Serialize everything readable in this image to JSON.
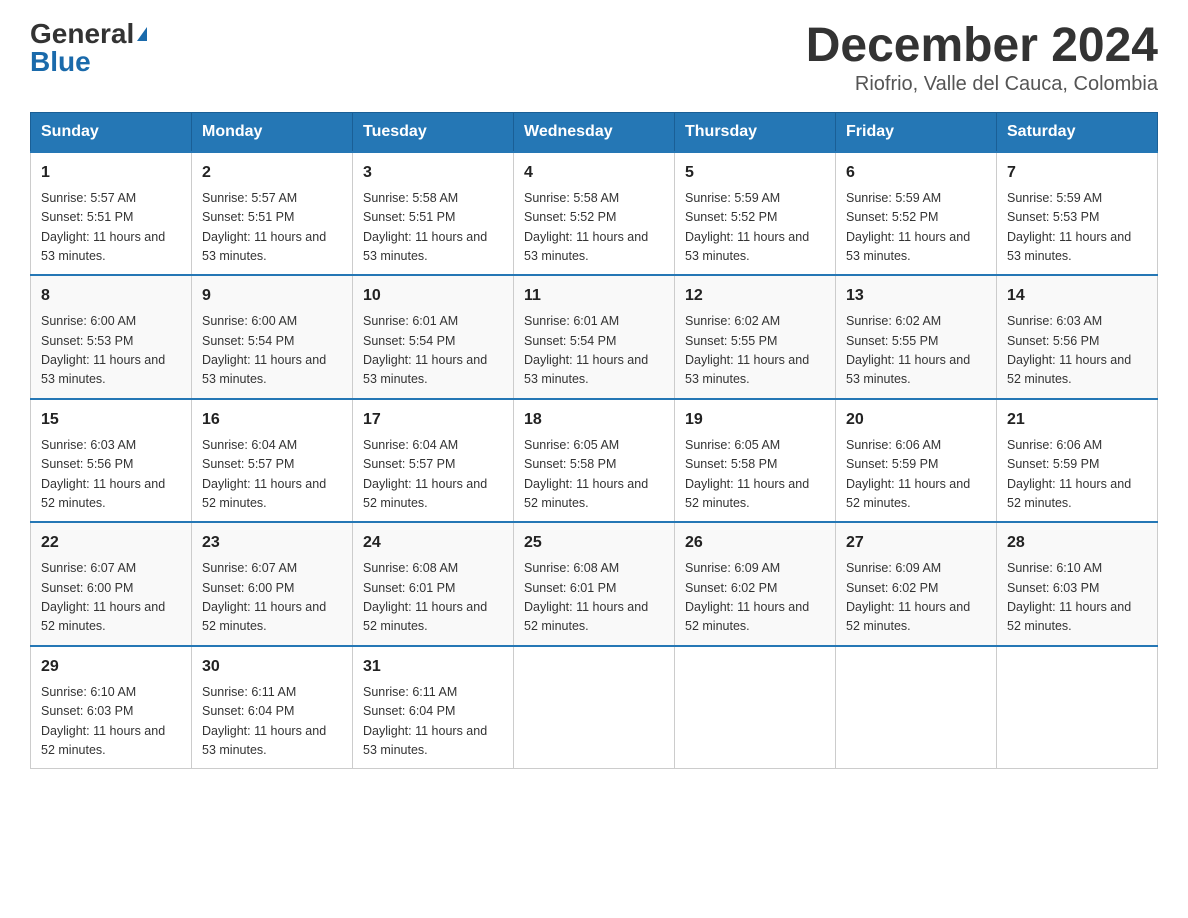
{
  "header": {
    "logo_general": "General",
    "logo_blue": "Blue",
    "month_title": "December 2024",
    "location": "Riofrio, Valle del Cauca, Colombia"
  },
  "days_of_week": [
    "Sunday",
    "Monday",
    "Tuesday",
    "Wednesday",
    "Thursday",
    "Friday",
    "Saturday"
  ],
  "weeks": [
    [
      {
        "day": "1",
        "sunrise": "5:57 AM",
        "sunset": "5:51 PM",
        "daylight": "11 hours and 53 minutes."
      },
      {
        "day": "2",
        "sunrise": "5:57 AM",
        "sunset": "5:51 PM",
        "daylight": "11 hours and 53 minutes."
      },
      {
        "day": "3",
        "sunrise": "5:58 AM",
        "sunset": "5:51 PM",
        "daylight": "11 hours and 53 minutes."
      },
      {
        "day": "4",
        "sunrise": "5:58 AM",
        "sunset": "5:52 PM",
        "daylight": "11 hours and 53 minutes."
      },
      {
        "day": "5",
        "sunrise": "5:59 AM",
        "sunset": "5:52 PM",
        "daylight": "11 hours and 53 minutes."
      },
      {
        "day": "6",
        "sunrise": "5:59 AM",
        "sunset": "5:52 PM",
        "daylight": "11 hours and 53 minutes."
      },
      {
        "day": "7",
        "sunrise": "5:59 AM",
        "sunset": "5:53 PM",
        "daylight": "11 hours and 53 minutes."
      }
    ],
    [
      {
        "day": "8",
        "sunrise": "6:00 AM",
        "sunset": "5:53 PM",
        "daylight": "11 hours and 53 minutes."
      },
      {
        "day": "9",
        "sunrise": "6:00 AM",
        "sunset": "5:54 PM",
        "daylight": "11 hours and 53 minutes."
      },
      {
        "day": "10",
        "sunrise": "6:01 AM",
        "sunset": "5:54 PM",
        "daylight": "11 hours and 53 minutes."
      },
      {
        "day": "11",
        "sunrise": "6:01 AM",
        "sunset": "5:54 PM",
        "daylight": "11 hours and 53 minutes."
      },
      {
        "day": "12",
        "sunrise": "6:02 AM",
        "sunset": "5:55 PM",
        "daylight": "11 hours and 53 minutes."
      },
      {
        "day": "13",
        "sunrise": "6:02 AM",
        "sunset": "5:55 PM",
        "daylight": "11 hours and 53 minutes."
      },
      {
        "day": "14",
        "sunrise": "6:03 AM",
        "sunset": "5:56 PM",
        "daylight": "11 hours and 52 minutes."
      }
    ],
    [
      {
        "day": "15",
        "sunrise": "6:03 AM",
        "sunset": "5:56 PM",
        "daylight": "11 hours and 52 minutes."
      },
      {
        "day": "16",
        "sunrise": "6:04 AM",
        "sunset": "5:57 PM",
        "daylight": "11 hours and 52 minutes."
      },
      {
        "day": "17",
        "sunrise": "6:04 AM",
        "sunset": "5:57 PM",
        "daylight": "11 hours and 52 minutes."
      },
      {
        "day": "18",
        "sunrise": "6:05 AM",
        "sunset": "5:58 PM",
        "daylight": "11 hours and 52 minutes."
      },
      {
        "day": "19",
        "sunrise": "6:05 AM",
        "sunset": "5:58 PM",
        "daylight": "11 hours and 52 minutes."
      },
      {
        "day": "20",
        "sunrise": "6:06 AM",
        "sunset": "5:59 PM",
        "daylight": "11 hours and 52 minutes."
      },
      {
        "day": "21",
        "sunrise": "6:06 AM",
        "sunset": "5:59 PM",
        "daylight": "11 hours and 52 minutes."
      }
    ],
    [
      {
        "day": "22",
        "sunrise": "6:07 AM",
        "sunset": "6:00 PM",
        "daylight": "11 hours and 52 minutes."
      },
      {
        "day": "23",
        "sunrise": "6:07 AM",
        "sunset": "6:00 PM",
        "daylight": "11 hours and 52 minutes."
      },
      {
        "day": "24",
        "sunrise": "6:08 AM",
        "sunset": "6:01 PM",
        "daylight": "11 hours and 52 minutes."
      },
      {
        "day": "25",
        "sunrise": "6:08 AM",
        "sunset": "6:01 PM",
        "daylight": "11 hours and 52 minutes."
      },
      {
        "day": "26",
        "sunrise": "6:09 AM",
        "sunset": "6:02 PM",
        "daylight": "11 hours and 52 minutes."
      },
      {
        "day": "27",
        "sunrise": "6:09 AM",
        "sunset": "6:02 PM",
        "daylight": "11 hours and 52 minutes."
      },
      {
        "day": "28",
        "sunrise": "6:10 AM",
        "sunset": "6:03 PM",
        "daylight": "11 hours and 52 minutes."
      }
    ],
    [
      {
        "day": "29",
        "sunrise": "6:10 AM",
        "sunset": "6:03 PM",
        "daylight": "11 hours and 52 minutes."
      },
      {
        "day": "30",
        "sunrise": "6:11 AM",
        "sunset": "6:04 PM",
        "daylight": "11 hours and 53 minutes."
      },
      {
        "day": "31",
        "sunrise": "6:11 AM",
        "sunset": "6:04 PM",
        "daylight": "11 hours and 53 minutes."
      },
      null,
      null,
      null,
      null
    ]
  ]
}
